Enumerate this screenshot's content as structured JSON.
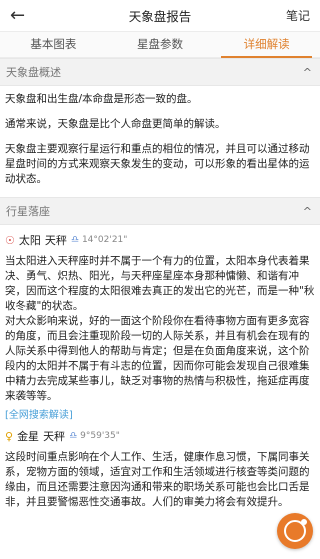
{
  "header": {
    "back_icon": "←",
    "title": "天象盘报告",
    "notes_label": "笔记"
  },
  "tabs": [
    {
      "label": "基本图表"
    },
    {
      "label": "星盘参数"
    },
    {
      "label": "详细解读"
    }
  ],
  "section_overview": {
    "title": "天象盘概述",
    "chevron": "^",
    "paragraphs": [
      "天象盘和出生盘/本命盘是形态一致的盘。",
      "通常来说，天象盘是比个人命盘更简单的解读。",
      "天象盘主要观察行星运行和重点的相位的情况，并且可以通过移动星盘时间的方式来观察天象发生的变动，可以形象的看出星体的运动状态。"
    ]
  },
  "section_planets": {
    "title": "行星落座",
    "chevron": "^",
    "items": [
      {
        "icon": "☉",
        "name": "太阳",
        "sign": "天秤",
        "sign_icon": "♎",
        "degree": "14°02'21\"",
        "paragraphs": [
          "当太阳进入天秤座时并不属于一个有力的位置，太阳本身代表着果决、勇气、炽热、阳光，与天秤座星座本身那种慵懒、和谐有冲突，因而这个程度的太阳很难去真正的发出它的光芒，而是一种\"秋收冬藏\"的状态。",
          "对大众影响来说，好的一面这个阶段你在看待事物方面有更多宽容的角度，而且会注重现阶段一切的人际关系，并且有机会在现有的人际关系中得到他人的帮助与肯定；但是在负面角度来说，这个阶段内的太阳并不属于有斗志的位置，因而你可能会发现自己很难集中精力去完成某些事儿，缺乏对事物的热情与积极性，拖延症再度来袭等等。"
        ],
        "more_label": "[全网搜索解读]"
      },
      {
        "icon": "♀",
        "name": "金星",
        "sign": "天秤",
        "sign_icon": "♎",
        "degree": "9°59'35\"",
        "paragraphs": [
          "这段时间重点影响在个人工作、生活，健康作息习惯，下属同事关系，宠物方面的领域，适宜对工作和生活领域进行核查等类问题的缘由，而且还需要注意因沟通和带来的职场关系可能也会比口舌是非，并且要警惕恶性交通事故。人们的审美力将会有效提升。"
        ],
        "more_label": "[全网搜索解读]"
      }
    ]
  },
  "fab_icon": "refresh-icon"
}
